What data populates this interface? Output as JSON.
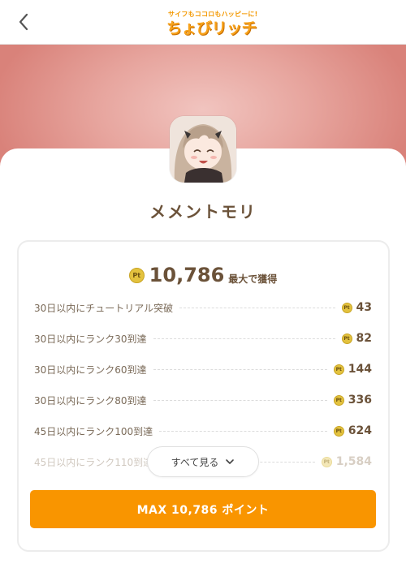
{
  "header": {
    "logo_tagline": "サイフもココロもハッピーに!",
    "logo_name": "ちょびリッチ"
  },
  "app": {
    "title": "メメントモリ"
  },
  "summary": {
    "coin_label": "Pt",
    "total_points": "10,786",
    "total_suffix": "最大で獲得"
  },
  "missions": [
    {
      "label": "30日以内にチュートリアル突破",
      "points": "43"
    },
    {
      "label": "30日以内にランク30到達",
      "points": "82"
    },
    {
      "label": "30日以内にランク60到達",
      "points": "144"
    },
    {
      "label": "30日以内にランク80到達",
      "points": "336"
    },
    {
      "label": "45日以内にランク100到達",
      "points": "624"
    },
    {
      "label": "45日以内にランク110到達",
      "points": "1,584"
    }
  ],
  "actions": {
    "see_all_label": "すべて見る",
    "max_button_label": "MAX 10,786 ポイント"
  },
  "colors": {
    "accent": "#f99500",
    "text_brown": "#6b5239",
    "coin": "#e3c23e",
    "hero_pink": "#e7a59e"
  }
}
